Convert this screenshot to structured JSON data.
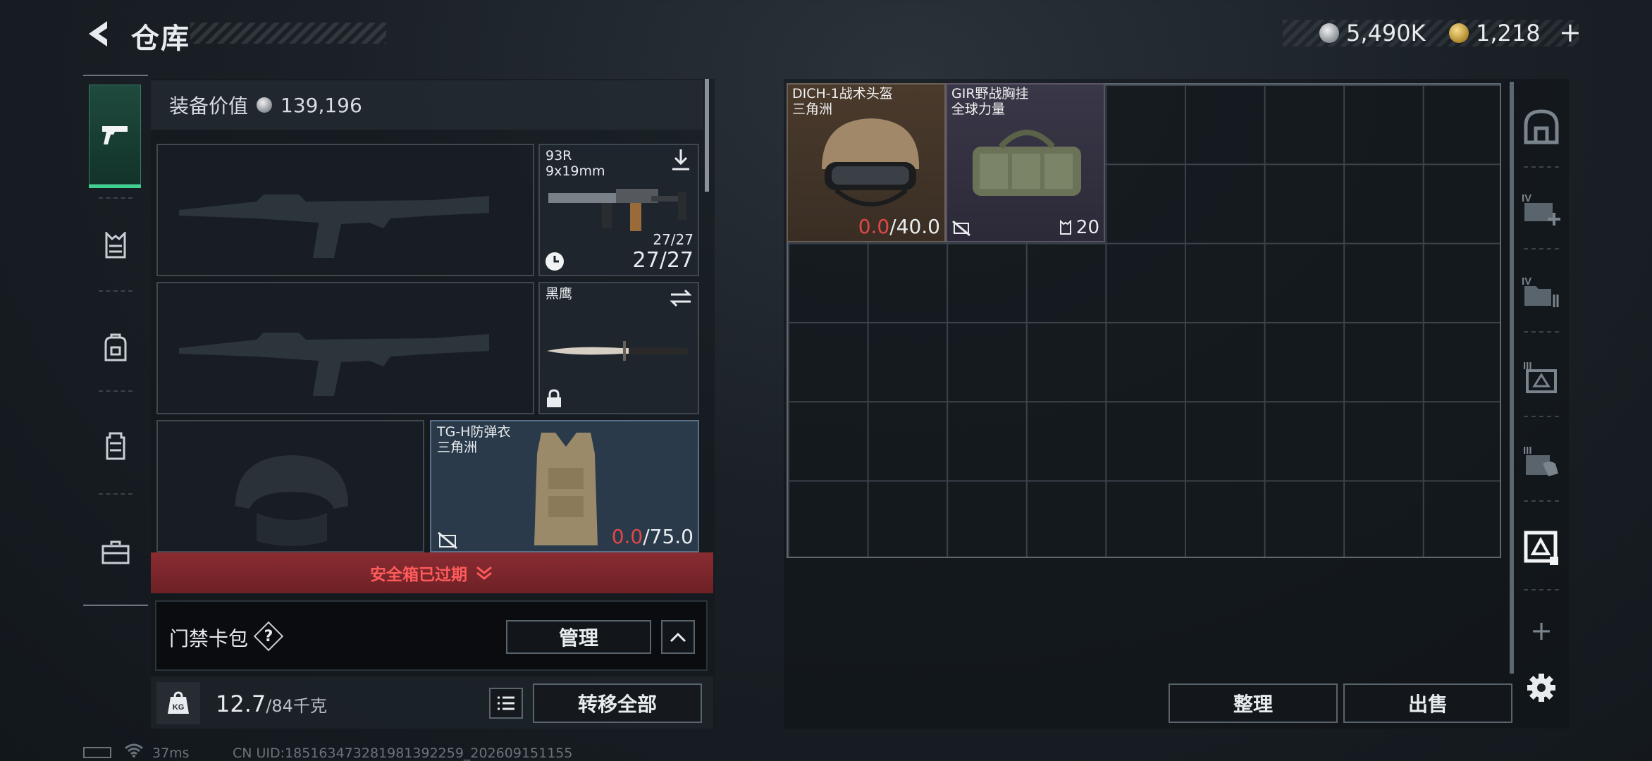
{
  "header": {
    "title": "仓库",
    "currency": [
      {
        "icon": "silver-coin-icon",
        "value": "5,490K"
      },
      {
        "icon": "gold-coin-icon",
        "value": "1,218"
      },
      {
        "plus": "+"
      }
    ]
  },
  "left_tabs": [
    {
      "icon": "pistol-icon",
      "active": true
    },
    {
      "icon": "chest-rig-icon"
    },
    {
      "icon": "backpack-icon"
    },
    {
      "icon": "vest-icon"
    },
    {
      "icon": "briefcase-icon"
    }
  ],
  "equipment": {
    "value_label": "装备价值",
    "value": "139,196",
    "sidearm": {
      "name": "93R",
      "caliber": "9x19mm",
      "ammo_small": "27/27",
      "ammo_big": "27/27"
    },
    "melee": {
      "name": "黑鹰"
    },
    "armor": {
      "name": "TG-H防弹衣",
      "brand": "三角洲",
      "durability_current": "0.0",
      "durability_max": "/75.0"
    }
  },
  "safebox": {
    "label": "安全箱已过期"
  },
  "access_card": {
    "label": "门禁卡包",
    "help": "?",
    "manage_button": "管理"
  },
  "weight": {
    "current": "12.7",
    "max": "/84千克"
  },
  "transfer_all_button": "转移全部",
  "stash_items": [
    {
      "name": "DICH-1战术头盔",
      "brand": "三角洲",
      "durability_current": "0.0",
      "durability_max": "/40.0"
    },
    {
      "name": "GIR野战胸挂",
      "brand": "全球力量",
      "capacity": "20"
    }
  ],
  "stash_buttons": {
    "sort": "整理",
    "sell": "出售"
  },
  "right_tabs": [
    {
      "icon": "safe-box-icon"
    },
    {
      "icon": "case-iv-add-icon",
      "badge": "IV"
    },
    {
      "icon": "case-iv-folder-icon",
      "badge": "IV"
    },
    {
      "icon": "case-iii-icon",
      "badge": "III"
    },
    {
      "icon": "case-iii-hand-icon",
      "badge": "III"
    },
    {
      "icon": "case-selected-icon"
    },
    {
      "icon": "add-icon",
      "label": "+"
    },
    {
      "icon": "gear-icon"
    }
  ],
  "status_bar": {
    "ping": "37ms",
    "uid": "CN UID:185163473281981392259_202609151155"
  }
}
